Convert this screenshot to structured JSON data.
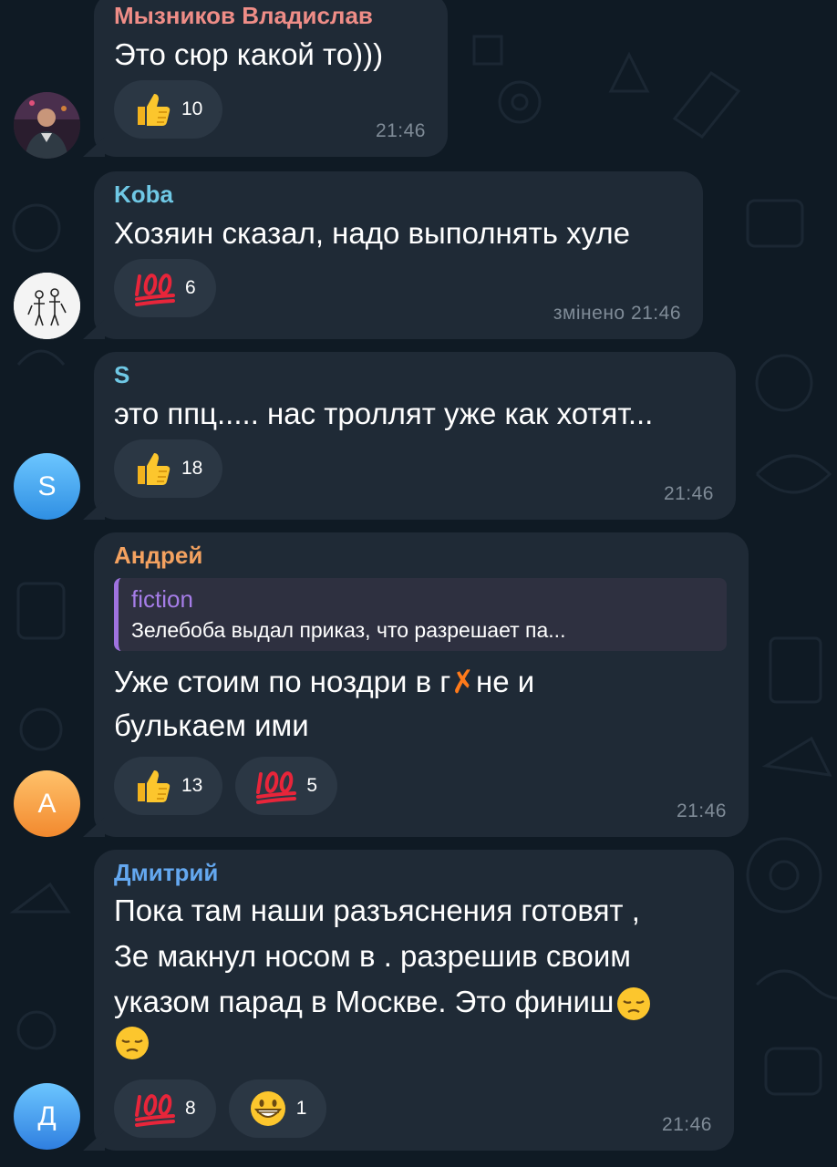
{
  "colors": {
    "background": "#0f1a24",
    "bubble": "#1f2a36",
    "reaction_pill": "#2b3744",
    "time": "#7f8b97"
  },
  "messages": [
    {
      "author": "Мызников Владислав",
      "author_color": "#ef8d87",
      "text": "Это сюр какой то)))",
      "reactions": [
        {
          "icon": "thumbs-up-icon",
          "count": "10"
        }
      ],
      "time": "21:46",
      "avatar": {
        "type": "photo",
        "initial": ""
      }
    },
    {
      "author": "Koba",
      "author_color": "#6fc8e5",
      "text": "Хозяин сказал, надо выполнять хуле",
      "reactions": [
        {
          "icon": "hundred-points-icon",
          "count": "6"
        }
      ],
      "time": "змінено 21:46",
      "avatar": {
        "type": "drawing",
        "initial": ""
      }
    },
    {
      "author": "S",
      "author_color": "#6fc8e5",
      "text": "это ппц..... нас троллят уже как хотят...",
      "reactions": [
        {
          "icon": "thumbs-up-icon",
          "count": "18"
        }
      ],
      "time": "21:46",
      "avatar": {
        "type": "initial",
        "initial": "S"
      }
    },
    {
      "author": "Андрей",
      "author_color": "#f4a260",
      "reply": {
        "author": "fiction",
        "text": "Зелебоба выдал приказ, что разрешает па..."
      },
      "text_lines": [
        "Уже стоим по ноздри в г",
        "не и",
        "булькаем ими"
      ],
      "reactions": [
        {
          "icon": "thumbs-up-icon",
          "count": "13"
        },
        {
          "icon": "hundred-points-icon",
          "count": "5"
        }
      ],
      "time": "21:46",
      "avatar": {
        "type": "initial",
        "initial": "А"
      }
    },
    {
      "author": "Дмитрий",
      "author_color": "#64a8f0",
      "text_lines": [
        "Пока там наши разъяснения готовят ,",
        "Зе макнул носом в . разрешив своим",
        "указом парад в Москве. Это финиш"
      ],
      "reactions": [
        {
          "icon": "hundred-points-icon",
          "count": "8"
        },
        {
          "icon": "grinning-face-icon",
          "count": "1"
        }
      ],
      "time": "21:46",
      "avatar": {
        "type": "initial",
        "initial": "Д"
      }
    }
  ]
}
